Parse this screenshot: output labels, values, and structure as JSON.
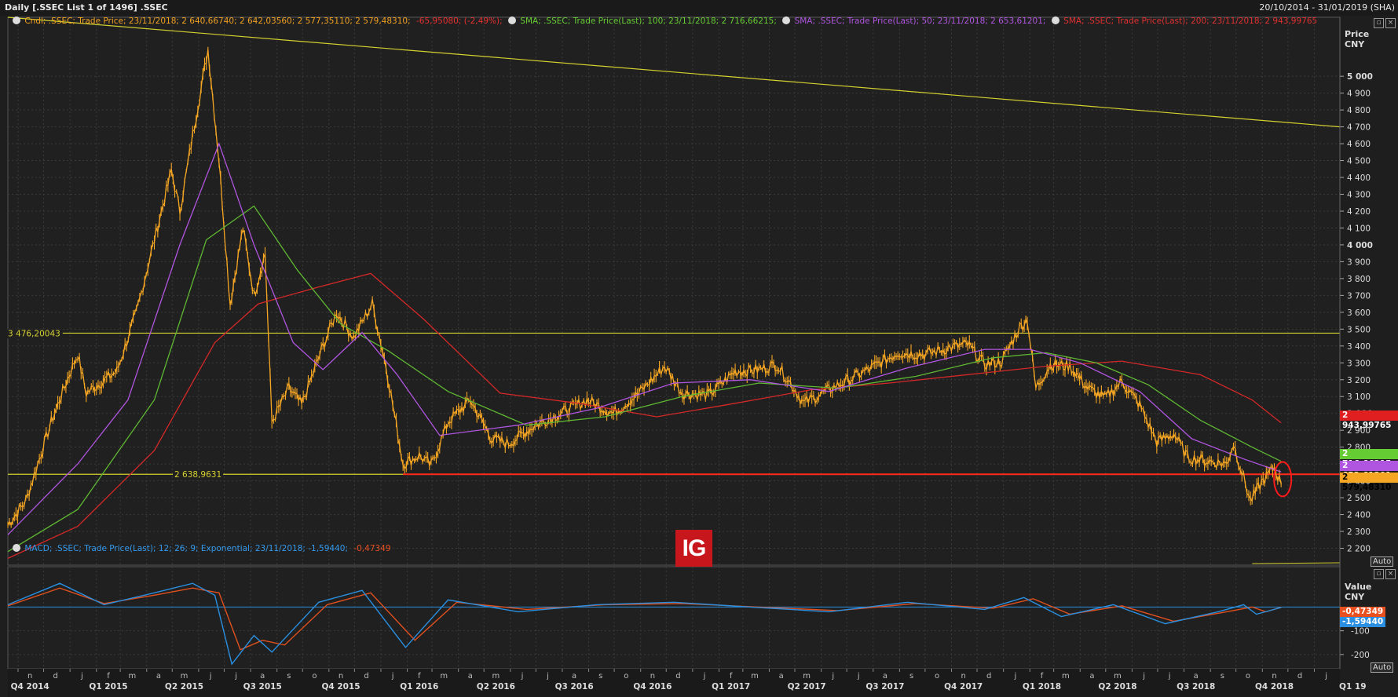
{
  "header": {
    "title": "Daily [.SSEC List 1 of 1496] .SSEC",
    "date_range": "20/10/2014 - 31/01/2019 (SHA)"
  },
  "legend_main": [
    {
      "text": "Cndl; .SSEC; Trade Price; 23/11/2018; 2 640,66740; 2 642,03560; 2 577,35110; 2 579,48310;",
      "color": "#f0a020"
    },
    {
      "text": "-65,95080; (-2,49%);",
      "color": "#e83030"
    },
    {
      "text": "SMA; .SSEC; Trade Price(Last);   100;  23/11/2018; 2 716,66215;",
      "color": "#66cc33"
    },
    {
      "text": "SMA; .SSEC; Trade Price(Last);   50;  23/11/2018; 2 653,61201;",
      "color": "#b055e0"
    },
    {
      "text": "SMA; .SSEC; Trade Price(Last);   200;  23/11/2018; 2 943,99765",
      "color": "#e03030"
    }
  ],
  "legend_macd": [
    {
      "text": "MACD; .SSEC; Trade Price(Last);  12; 26; 9; Exponential; 23/11/2018; -1,59440;",
      "color": "#3399ee"
    },
    {
      "text": "-0,47349",
      "color": "#e85020"
    }
  ],
  "axis_main": {
    "unit_title": "Price",
    "currency": "CNY",
    "auto": "Auto"
  },
  "axis_macd": {
    "unit_title": "Value",
    "currency": "CNY",
    "auto": "Auto"
  },
  "price_badges": {
    "sma200": "2 943,99765",
    "sma100": "2 716,66215",
    "sma50": "2 653,61201",
    "last": "2 579,48310"
  },
  "macd_badges": {
    "signal": "-0,47349",
    "macd": "-1,59440"
  },
  "hlines": {
    "upper": "3 476,20043",
    "lower": "2 638,9631"
  },
  "logo": "IG",
  "colors": {
    "candle": "#f5a623",
    "sma50": "#b055e0",
    "sma100": "#5fb832",
    "sma200": "#d42828",
    "hline": "#d4d030",
    "support": "#ff2a1a",
    "macd": "#2a8fe0",
    "signal": "#e0501e",
    "grid": "#3a3a3a"
  },
  "chart_data": {
    "type": "line",
    "price_ylim": [
      2100,
      5350
    ],
    "price_ticks": [
      2200,
      2300,
      2400,
      2500,
      2600,
      2700,
      2800,
      2900,
      3000,
      3100,
      3200,
      3300,
      3400,
      3500,
      3600,
      3700,
      3800,
      3900,
      4000,
      4100,
      4200,
      4300,
      4400,
      4500,
      4600,
      4700,
      4800,
      4900,
      5000
    ],
    "price_tick_labels": [
      "2 200",
      "2 300",
      "2 400",
      "2 500",
      "2 600",
      "2 700",
      "2 800",
      "2 900",
      "3 000",
      "3 100",
      "3 200",
      "3 300",
      "3 400",
      "3 500",
      "3 600",
      "3 700",
      "3 800",
      "3 900",
      "4 000",
      "4 100",
      "4 200",
      "4 300",
      "4 400",
      "4 500",
      "4 600",
      "4 700",
      "4 800",
      "4 900",
      "5 000"
    ],
    "macd_ylim": [
      -260,
      170
    ],
    "macd_ticks": [
      -100,
      -200
    ],
    "macd_tick_labels": [
      "-100",
      "-200"
    ],
    "x_range": [
      "2014-10-20",
      "2019-01-31"
    ],
    "quarter_labels": [
      {
        "label": "Q4 2014",
        "date": "2014-11-15"
      },
      {
        "label": "Q1 2015",
        "date": "2015-02-15"
      },
      {
        "label": "Q2 2015",
        "date": "2015-05-15"
      },
      {
        "label": "Q3 2015",
        "date": "2015-08-15"
      },
      {
        "label": "Q4 2015",
        "date": "2015-11-15"
      },
      {
        "label": "Q1 2016",
        "date": "2016-02-15"
      },
      {
        "label": "Q2 2016",
        "date": "2016-05-15"
      },
      {
        "label": "Q3 2016",
        "date": "2016-08-15"
      },
      {
        "label": "Q4 2016",
        "date": "2016-11-15"
      },
      {
        "label": "Q1 2017",
        "date": "2017-02-15"
      },
      {
        "label": "Q2 2017",
        "date": "2017-05-15"
      },
      {
        "label": "Q3 2017",
        "date": "2017-08-15"
      },
      {
        "label": "Q4 2017",
        "date": "2017-11-15"
      },
      {
        "label": "Q1 2018",
        "date": "2018-02-15"
      },
      {
        "label": "Q2 2018",
        "date": "2018-05-15"
      },
      {
        "label": "Q3 2018",
        "date": "2018-08-15"
      },
      {
        "label": "Q4 2018",
        "date": "2018-11-15"
      },
      {
        "label": "Q1 19",
        "date": "2019-02-15"
      }
    ],
    "month_labels": [
      "n",
      "d",
      "j",
      "f",
      "m",
      "a",
      "m",
      "j",
      "j",
      "a",
      "s",
      "o",
      "n",
      "d",
      "j",
      "f",
      "m",
      "a",
      "m",
      "j",
      "j",
      "a",
      "s",
      "o",
      "n",
      "d",
      "j",
      "f",
      "m",
      "a",
      "m",
      "j",
      "j",
      "a",
      "s",
      "o",
      "n",
      "d",
      "j",
      "f",
      "m",
      "a",
      "m",
      "j",
      "j",
      "a",
      "s",
      "o",
      "n",
      "d",
      "j",
      "f",
      "m",
      "a",
      "m",
      "j",
      "j",
      "a",
      "s",
      "o",
      "n",
      "d"
    ],
    "series": [
      {
        "name": "Cndl; .SSEC; Trade Price",
        "key": "price",
        "points": [
          [
            "2014-10-20",
            2340
          ],
          [
            "2014-11-10",
            2480
          ],
          [
            "2014-12-10",
            2950
          ],
          [
            "2014-12-31",
            3230
          ],
          [
            "2015-01-10",
            3350
          ],
          [
            "2015-01-20",
            3120
          ],
          [
            "2015-02-05",
            3180
          ],
          [
            "2015-02-25",
            3250
          ],
          [
            "2015-03-20",
            3600
          ],
          [
            "2015-04-10",
            4030
          ],
          [
            "2015-04-30",
            4440
          ],
          [
            "2015-05-10",
            4200
          ],
          [
            "2015-05-25",
            4650
          ],
          [
            "2015-06-12",
            5160
          ],
          [
            "2015-06-25",
            4500
          ],
          [
            "2015-07-08",
            3650
          ],
          [
            "2015-07-23",
            4100
          ],
          [
            "2015-08-05",
            3700
          ],
          [
            "2015-08-18",
            3950
          ],
          [
            "2015-08-26",
            2950
          ],
          [
            "2015-09-15",
            3150
          ],
          [
            "2015-09-30",
            3050
          ],
          [
            "2015-10-25",
            3400
          ],
          [
            "2015-11-10",
            3600
          ],
          [
            "2015-11-30",
            3450
          ],
          [
            "2015-12-22",
            3650
          ],
          [
            "2016-01-07",
            3280
          ],
          [
            "2016-01-27",
            2700
          ],
          [
            "2016-02-15",
            2750
          ],
          [
            "2016-02-29",
            2690
          ],
          [
            "2016-03-20",
            2950
          ],
          [
            "2016-04-15",
            3080
          ],
          [
            "2016-05-10",
            2850
          ],
          [
            "2016-05-30",
            2820
          ],
          [
            "2016-06-30",
            2930
          ],
          [
            "2016-07-30",
            3000
          ],
          [
            "2016-08-30",
            3080
          ],
          [
            "2016-09-30",
            3000
          ],
          [
            "2016-10-30",
            3120
          ],
          [
            "2016-11-29",
            3280
          ],
          [
            "2016-12-20",
            3120
          ],
          [
            "2017-01-20",
            3110
          ],
          [
            "2017-02-20",
            3250
          ],
          [
            "2017-03-20",
            3260
          ],
          [
            "2017-04-10",
            3290
          ],
          [
            "2017-04-30",
            3150
          ],
          [
            "2017-05-11",
            3060
          ],
          [
            "2017-06-10",
            3140
          ],
          [
            "2017-06-30",
            3190
          ],
          [
            "2017-07-30",
            3270
          ],
          [
            "2017-08-30",
            3360
          ],
          [
            "2017-09-30",
            3350
          ],
          [
            "2017-10-30",
            3390
          ],
          [
            "2017-11-20",
            3410
          ],
          [
            "2017-12-10",
            3290
          ],
          [
            "2017-12-30",
            3310
          ],
          [
            "2018-01-20",
            3510
          ],
          [
            "2018-01-29",
            3560
          ],
          [
            "2018-02-08",
            3150
          ],
          [
            "2018-02-25",
            3290
          ],
          [
            "2018-03-20",
            3280
          ],
          [
            "2018-04-10",
            3150
          ],
          [
            "2018-04-30",
            3090
          ],
          [
            "2018-05-20",
            3190
          ],
          [
            "2018-06-10",
            3050
          ],
          [
            "2018-06-30",
            2830
          ],
          [
            "2018-07-20",
            2880
          ],
          [
            "2018-08-05",
            2740
          ],
          [
            "2018-08-25",
            2720
          ],
          [
            "2018-09-20",
            2700
          ],
          [
            "2018-09-28",
            2820
          ],
          [
            "2018-10-18",
            2480
          ],
          [
            "2018-10-31",
            2590
          ],
          [
            "2018-11-15",
            2680
          ],
          [
            "2018-11-23",
            2579
          ]
        ]
      },
      {
        "name": "SMA 50",
        "key": "sma50",
        "points": [
          [
            "2014-10-20",
            2280
          ],
          [
            "2015-01-10",
            2700
          ],
          [
            "2015-03-10",
            3080
          ],
          [
            "2015-05-10",
            4000
          ],
          [
            "2015-06-25",
            4600
          ],
          [
            "2015-08-05",
            4000
          ],
          [
            "2015-09-20",
            3420
          ],
          [
            "2015-10-25",
            3260
          ],
          [
            "2015-12-10",
            3480
          ],
          [
            "2016-01-20",
            3230
          ],
          [
            "2016-03-10",
            2870
          ],
          [
            "2016-06-10",
            2930
          ],
          [
            "2016-09-10",
            3030
          ],
          [
            "2016-12-10",
            3180
          ],
          [
            "2017-03-10",
            3200
          ],
          [
            "2017-06-10",
            3130
          ],
          [
            "2017-09-10",
            3270
          ],
          [
            "2017-12-10",
            3380
          ],
          [
            "2018-02-01",
            3380
          ],
          [
            "2018-04-01",
            3300
          ],
          [
            "2018-06-10",
            3130
          ],
          [
            "2018-08-10",
            2850
          ],
          [
            "2018-10-10",
            2730
          ],
          [
            "2018-11-23",
            2653
          ]
        ]
      },
      {
        "name": "SMA 100",
        "key": "sma100",
        "points": [
          [
            "2014-10-20",
            2180
          ],
          [
            "2015-01-10",
            2430
          ],
          [
            "2015-04-10",
            3080
          ],
          [
            "2015-06-10",
            4030
          ],
          [
            "2015-08-05",
            4230
          ],
          [
            "2015-09-25",
            3850
          ],
          [
            "2015-11-15",
            3530
          ],
          [
            "2016-01-10",
            3370
          ],
          [
            "2016-03-20",
            3130
          ],
          [
            "2016-06-20",
            2930
          ],
          [
            "2016-09-20",
            2980
          ],
          [
            "2016-12-20",
            3100
          ],
          [
            "2017-03-20",
            3180
          ],
          [
            "2017-06-20",
            3150
          ],
          [
            "2017-09-20",
            3220
          ],
          [
            "2017-12-20",
            3330
          ],
          [
            "2018-02-20",
            3360
          ],
          [
            "2018-04-20",
            3300
          ],
          [
            "2018-06-20",
            3170
          ],
          [
            "2018-08-20",
            2960
          ],
          [
            "2018-10-20",
            2800
          ],
          [
            "2018-11-23",
            2716
          ]
        ]
      },
      {
        "name": "SMA 200",
        "key": "sma200",
        "points": [
          [
            "2014-10-20",
            2140
          ],
          [
            "2015-01-10",
            2330
          ],
          [
            "2015-04-10",
            2780
          ],
          [
            "2015-06-20",
            3420
          ],
          [
            "2015-08-10",
            3650
          ],
          [
            "2015-10-20",
            3750
          ],
          [
            "2015-12-20",
            3830
          ],
          [
            "2016-02-20",
            3560
          ],
          [
            "2016-05-20",
            3120
          ],
          [
            "2016-08-20",
            3060
          ],
          [
            "2016-11-20",
            2980
          ],
          [
            "2017-02-20",
            3060
          ],
          [
            "2017-05-20",
            3140
          ],
          [
            "2017-08-20",
            3180
          ],
          [
            "2017-11-20",
            3230
          ],
          [
            "2018-02-20",
            3280
          ],
          [
            "2018-05-20",
            3310
          ],
          [
            "2018-08-20",
            3230
          ],
          [
            "2018-10-20",
            3080
          ],
          [
            "2018-11-23",
            2944
          ]
        ]
      },
      {
        "name": "MACD",
        "key": "macd",
        "points": [
          [
            "2014-10-20",
            10
          ],
          [
            "2014-12-20",
            100
          ],
          [
            "2015-02-10",
            10
          ],
          [
            "2015-04-10",
            60
          ],
          [
            "2015-05-25",
            100
          ],
          [
            "2015-06-20",
            50
          ],
          [
            "2015-07-10",
            -240
          ],
          [
            "2015-08-05",
            -120
          ],
          [
            "2015-08-26",
            -190
          ],
          [
            "2015-10-20",
            20
          ],
          [
            "2015-12-10",
            70
          ],
          [
            "2016-01-30",
            -170
          ],
          [
            "2016-03-20",
            30
          ],
          [
            "2016-06-10",
            -20
          ],
          [
            "2016-09-10",
            10
          ],
          [
            "2016-12-10",
            20
          ],
          [
            "2017-03-10",
            0
          ],
          [
            "2017-06-10",
            -20
          ],
          [
            "2017-09-10",
            20
          ],
          [
            "2017-12-10",
            -10
          ],
          [
            "2018-01-25",
            40
          ],
          [
            "2018-03-10",
            -40
          ],
          [
            "2018-05-10",
            10
          ],
          [
            "2018-07-10",
            -70
          ],
          [
            "2018-09-10",
            -20
          ],
          [
            "2018-10-10",
            10
          ],
          [
            "2018-10-25",
            -30
          ],
          [
            "2018-11-23",
            -2
          ]
        ]
      },
      {
        "name": "Signal",
        "key": "signal",
        "points": [
          [
            "2014-10-20",
            5
          ],
          [
            "2014-12-20",
            80
          ],
          [
            "2015-02-10",
            15
          ],
          [
            "2015-04-10",
            50
          ],
          [
            "2015-05-25",
            80
          ],
          [
            "2015-06-25",
            60
          ],
          [
            "2015-07-20",
            -180
          ],
          [
            "2015-08-15",
            -140
          ],
          [
            "2015-09-10",
            -160
          ],
          [
            "2015-10-30",
            10
          ],
          [
            "2015-12-20",
            60
          ],
          [
            "2016-02-10",
            -140
          ],
          [
            "2016-03-30",
            20
          ],
          [
            "2016-06-20",
            -10
          ],
          [
            "2016-09-20",
            10
          ],
          [
            "2016-12-20",
            15
          ],
          [
            "2017-03-20",
            0
          ],
          [
            "2017-06-20",
            -15
          ],
          [
            "2017-09-20",
            15
          ],
          [
            "2017-12-20",
            -5
          ],
          [
            "2018-02-05",
            35
          ],
          [
            "2018-03-20",
            -30
          ],
          [
            "2018-05-20",
            5
          ],
          [
            "2018-07-20",
            -60
          ],
          [
            "2018-09-20",
            -20
          ],
          [
            "2018-10-20",
            0
          ],
          [
            "2018-11-05",
            -20
          ],
          [
            "2018-11-23",
            -1
          ]
        ]
      }
    ],
    "hlines": [
      {
        "value": 3476.2,
        "label": "3 476,20043"
      },
      {
        "value": 2638.96,
        "label": "2 638,9631"
      }
    ],
    "support_segment": {
      "from": "2016-01-27",
      "to": "2018-11-23",
      "value": 2638.96
    },
    "trendline": {
      "from": [
        "2014-10-20",
        5370
      ],
      "to": [
        "2019-01-31",
        4700
      ]
    },
    "highlight_circle": {
      "date": "2018-11-23",
      "value": 2610
    }
  }
}
